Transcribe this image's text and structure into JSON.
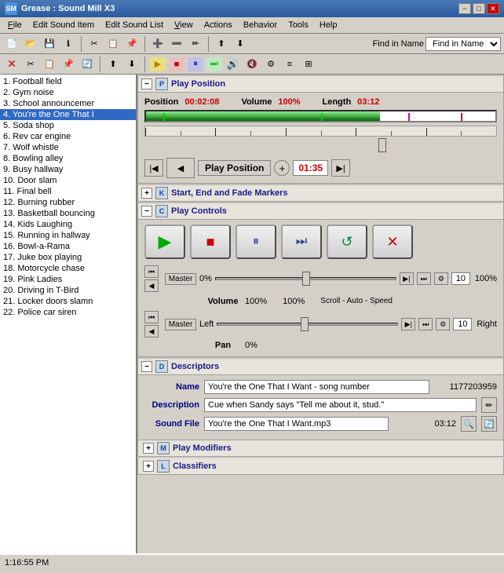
{
  "app": {
    "title": "Grease : Sound Mill X3",
    "icon": "SM"
  },
  "titlebar": {
    "minimize": "−",
    "maximize": "□",
    "close": "✕"
  },
  "menu": {
    "items": [
      "File",
      "Edit Sound Item",
      "Edit Sound List",
      "View",
      "Actions",
      "Behavior",
      "Tools",
      "Help"
    ]
  },
  "toolbar": {
    "find_label": "Find in Name",
    "find_dropdown": "▼"
  },
  "sound_list": {
    "items": [
      {
        "num": 1,
        "name": "Football field",
        "state": "normal"
      },
      {
        "num": 2,
        "name": "Gym noise",
        "state": "normal"
      },
      {
        "num": 3,
        "name": "School announcemer",
        "state": "normal"
      },
      {
        "num": 4,
        "name": "You're the One That I",
        "state": "selected"
      },
      {
        "num": 5,
        "name": "Soda shop",
        "state": "normal"
      },
      {
        "num": 6,
        "name": "Rev car engine",
        "state": "normal"
      },
      {
        "num": 7,
        "name": "Wolf whistle",
        "state": "normal"
      },
      {
        "num": 8,
        "name": "Bowling alley",
        "state": "normal"
      },
      {
        "num": 9,
        "name": "Busy hallway",
        "state": "normal"
      },
      {
        "num": 10,
        "name": "Door slam",
        "state": "normal"
      },
      {
        "num": 11,
        "name": "Final bell",
        "state": "normal"
      },
      {
        "num": 12,
        "name": "Burning rubber",
        "state": "normal"
      },
      {
        "num": 13,
        "name": "Basketball bouncing",
        "state": "normal"
      },
      {
        "num": 14,
        "name": "Kids Laughing",
        "state": "normal"
      },
      {
        "num": 15,
        "name": "Running in hallway",
        "state": "normal"
      },
      {
        "num": 16,
        "name": "Bowl-a-Rama",
        "state": "normal"
      },
      {
        "num": 17,
        "name": "Juke box playing",
        "state": "normal"
      },
      {
        "num": 18,
        "name": "Motorcycle chase",
        "state": "normal"
      },
      {
        "num": 19,
        "name": "Pink Ladies",
        "state": "normal"
      },
      {
        "num": 20,
        "name": "Driving in T-Bird",
        "state": "normal"
      },
      {
        "num": 21,
        "name": "Locker doors slamn",
        "state": "normal"
      },
      {
        "num": 22,
        "name": "Police car siren",
        "state": "normal"
      }
    ]
  },
  "play_position": {
    "section_label": "Play Position",
    "section_icon": "P",
    "position_label": "Position",
    "position_value": "00:02:08",
    "volume_label": "Volume",
    "volume_value": "100%",
    "length_label": "Length",
    "length_value": "03:12",
    "progress_pct": 67,
    "playpos_label": "Play Position",
    "playpos_time": "01:35",
    "btn_start": "|◀",
    "btn_back": "◀",
    "btn_plus": "+",
    "btn_end": "▶|"
  },
  "start_end_fade": {
    "section_label": "Start, End and Fade Markers",
    "section_icon": "K",
    "collapsed": true
  },
  "play_controls": {
    "section_label": "Play Controls",
    "section_icon": "C",
    "btn_play": "▶",
    "btn_stop": "■",
    "btn_pause": "⏸",
    "btn_forward": "▶▶",
    "btn_loop": "↺",
    "btn_close": "✕",
    "volume_label": "Volume",
    "volume_left_pct": "0%",
    "volume_center_pct": "100%",
    "volume_right_pct": "100%",
    "scroll_auto_speed": "Scroll - Auto - Speed",
    "scroll_num": "10",
    "pan_label": "Pan",
    "pan_left": "Left",
    "pan_right": "Right",
    "pan_pct": "0%",
    "pan_num": "10",
    "master_label": "Master"
  },
  "descriptors": {
    "section_label": "Descriptors",
    "section_icon": "D",
    "name_label": "Name",
    "name_value": "You're the One That I Want - song number",
    "name_id": "1177203959",
    "desc_label": "Description",
    "desc_value": "Cue when Sandy says \"Tell me about it, stud.\"",
    "file_label": "Sound File",
    "file_value": "You're the One That I Want.mp3",
    "file_duration": "03:12"
  },
  "play_modifiers": {
    "section_label": "Play Modifiers",
    "section_icon": "M",
    "collapsed": true
  },
  "classifiers": {
    "section_label": "Classifiers",
    "section_icon": "L",
    "collapsed": true
  },
  "status_bar": {
    "time": "1:16:55 PM"
  }
}
